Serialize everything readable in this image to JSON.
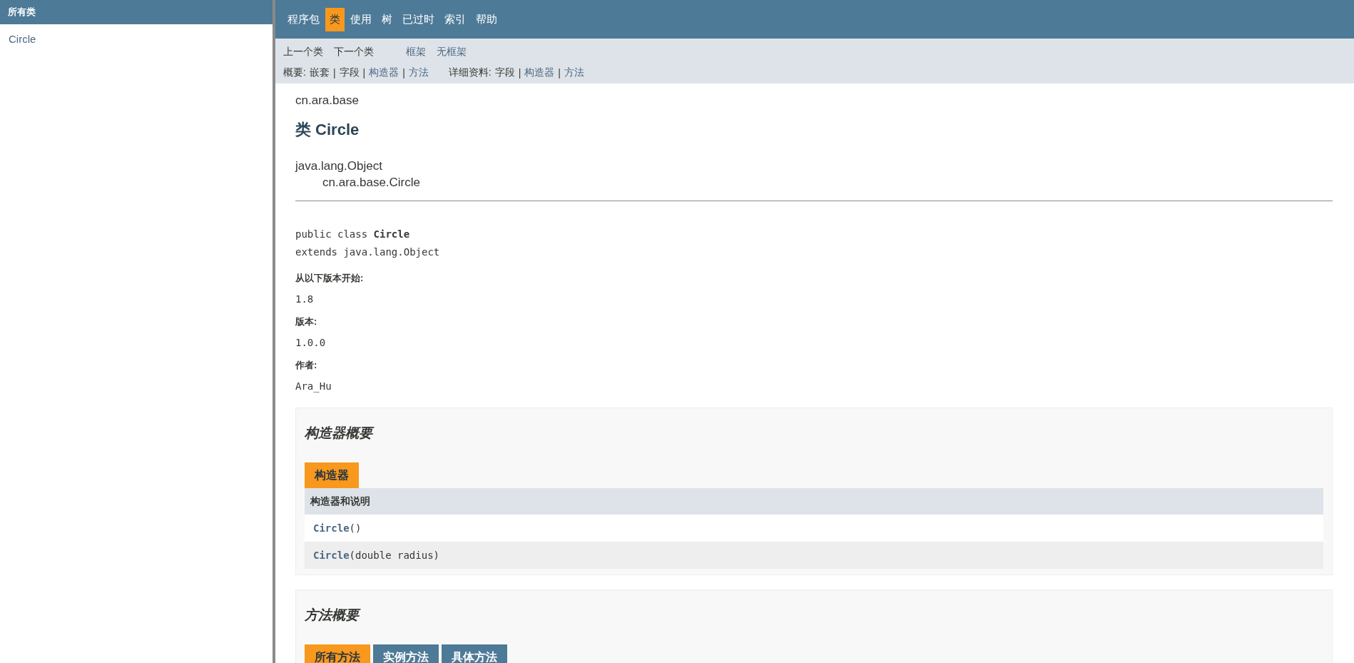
{
  "sidebar": {
    "title": "所有类",
    "items": [
      {
        "label": "Circle"
      }
    ]
  },
  "nav": {
    "items": [
      {
        "label": "程序包",
        "selected": false
      },
      {
        "label": "类",
        "selected": true
      },
      {
        "label": "使用",
        "selected": false
      },
      {
        "label": "树",
        "selected": false
      },
      {
        "label": "已过时",
        "selected": false
      },
      {
        "label": "索引",
        "selected": false
      },
      {
        "label": "帮助",
        "selected": false
      }
    ]
  },
  "subnav": {
    "links": [
      {
        "label": "上一个类",
        "kind": "plain"
      },
      {
        "label": "下一个类",
        "kind": "plain"
      },
      {
        "label": "框架",
        "kind": "link"
      },
      {
        "label": "无框架",
        "kind": "link"
      }
    ],
    "summary": {
      "label": "概要:",
      "items": [
        {
          "label": "嵌套",
          "kind": "plain"
        },
        {
          "label": "字段",
          "kind": "plain"
        },
        {
          "label": "构造器",
          "kind": "link"
        },
        {
          "label": "方法",
          "kind": "link"
        }
      ]
    },
    "detail": {
      "label": "详细资料:",
      "items": [
        {
          "label": "字段",
          "kind": "plain"
        },
        {
          "label": "构造器",
          "kind": "link"
        },
        {
          "label": "方法",
          "kind": "link"
        }
      ]
    },
    "separator": "|"
  },
  "content": {
    "package": "cn.ara.base",
    "title": "类 Circle",
    "inheritance": [
      "java.lang.Object",
      "cn.ara.base.Circle"
    ],
    "signature": [
      "public class **Circle**",
      "extends java.lang.Object"
    ],
    "tags": [
      {
        "label": "从以下版本开始:",
        "value": "1.8"
      },
      {
        "label": "版本:",
        "value": "1.0.0"
      },
      {
        "label": "作者:",
        "value": "Ara_Hu"
      }
    ]
  },
  "constructor_summary": {
    "title": "构造器概要",
    "tabs": [
      {
        "label": "构造器",
        "selected": true
      }
    ],
    "header": "构造器和说明",
    "rows": [
      {
        "name": "Circle",
        "params": "()"
      },
      {
        "name": "Circle",
        "params": "(double  radius)"
      }
    ]
  },
  "method_summary": {
    "title": "方法概要",
    "tabs": [
      {
        "label": "所有方法",
        "selected": true
      },
      {
        "label": "实例方法",
        "selected": false
      },
      {
        "label": "具体方法",
        "selected": false
      }
    ]
  }
}
